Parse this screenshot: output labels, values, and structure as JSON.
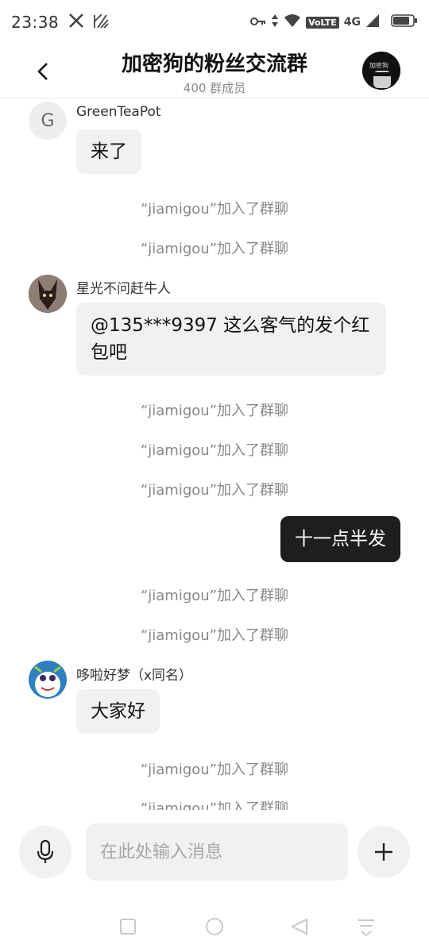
{
  "status_bar": {
    "time": "23:38",
    "left_icons": [
      "x-logo-icon",
      "app-logo-icon"
    ],
    "right_icons": [
      "vpn-key-icon",
      "data-arrows-icon",
      "wifi-icon",
      "signal-icon",
      "battery-icon"
    ],
    "volte": "VoLTE",
    "network": "4G"
  },
  "header": {
    "title": "加密狗的粉丝交流群",
    "member_count": "400 群成员",
    "avatar_text": "加密狗"
  },
  "messages": {
    "m1": {
      "avatar_letter": "G",
      "sender": "GreenTeaPot",
      "text": "来了"
    },
    "s1": "“jiamigou”加入了群聊",
    "s2": "“jiamigou”加入了群聊",
    "m2": {
      "sender": "星光不问赶牛人",
      "line1": "@135***9397 这么客气的发个红",
      "line2": "包吧"
    },
    "s3": "“jiamigou”加入了群聊",
    "s4": "“jiamigou”加入了群聊",
    "s5": "“jiamigou”加入了群聊",
    "m3": {
      "text": "十一点半发"
    },
    "s6": "“jiamigou”加入了群聊",
    "s7": "“jiamigou”加入了群聊",
    "m4": {
      "sender": "哆啦好梦（x同名）",
      "text": "大家好"
    },
    "s8": "“jiamigou”加入了群聊",
    "s9": "“jiamigou”加入了群聊"
  },
  "input": {
    "placeholder": "在此处输入消息"
  },
  "colors": {
    "self_bubble": "#1e1e1e",
    "other_bubble": "#f1f1f1",
    "system_text": "#888888"
  }
}
